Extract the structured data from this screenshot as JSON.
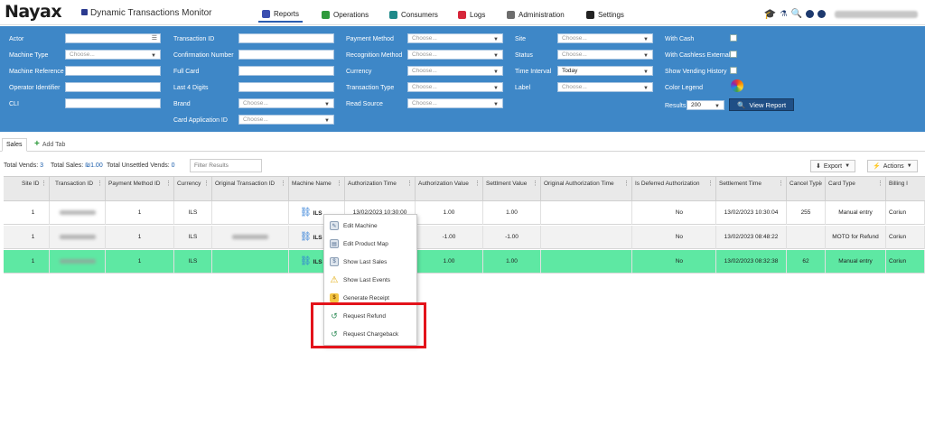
{
  "app": {
    "logo": "Nayax",
    "title": "Dynamic Transactions Monitor"
  },
  "nav": [
    {
      "label": "Reports",
      "color": "#3b4fb0",
      "active": true
    },
    {
      "label": "Operations",
      "color": "#2e9a3c"
    },
    {
      "label": "Consumers",
      "color": "#1f8a8a"
    },
    {
      "label": "Logs",
      "color": "#d6263a"
    },
    {
      "label": "Administration",
      "color": "#6d6d6d"
    },
    {
      "label": "Settings",
      "color": "#222222"
    }
  ],
  "filters": {
    "actor": "Actor",
    "machine_type": "Machine Type",
    "machine_type_value": "Choose...",
    "machine_reference": "Machine Reference",
    "operator_identifier": "Operator Identifier",
    "cli": "CLI",
    "transaction_id": "Transaction ID",
    "confirmation_number": "Confirmation Number",
    "full_card": "Full Card",
    "last4": "Last 4 Digits",
    "brand": "Brand",
    "brand_value": "Choose...",
    "card_application_id": "Card Application ID",
    "card_application_id_value": "Choose...",
    "payment_method": "Payment Method",
    "payment_method_value": "Choose...",
    "recognition_method": "Recognition Method",
    "recognition_method_value": "Choose...",
    "currency": "Currency",
    "currency_value": "Choose...",
    "transaction_type": "Transaction Type",
    "transaction_type_value": "Choose...",
    "read_source": "Read Source",
    "read_source_value": "Choose...",
    "site": "Site",
    "site_value": "Choose...",
    "status": "Status",
    "status_value": "Choose...",
    "time_interval": "Time Interval",
    "time_interval_value": "Today",
    "label": "Label",
    "label_value": "Choose...",
    "with_cash": "With Cash",
    "with_cashless_external": "With Cashless External",
    "show_vending_history": "Show Vending History",
    "color_legend": "Color Legend",
    "results": "Results",
    "results_value": "200",
    "view_report": "View Report"
  },
  "tabs": {
    "sales": "Sales",
    "add_tab": "Add Tab"
  },
  "totals": {
    "vends_label": "Total Vends:",
    "vends_value": "3",
    "sales_label": "Total Sales:",
    "sales_value": "₪1.00",
    "unsettled_label": "Total Unsettled Vends:",
    "unsettled_value": "0",
    "filter_placeholder": "Filter Results"
  },
  "toolbar": {
    "export": "Export",
    "actions": "Actions"
  },
  "grid": {
    "headers": [
      "Site ID",
      "Transaction ID",
      "Payment Method ID",
      "Currency",
      "Original Transaction ID",
      "Machine Name",
      "Authorization Time",
      "Authorization Value",
      "Settlment Value",
      "Original Authorization Time",
      "Is Deferred Authorization",
      "Settlement Time",
      "Cancel Type",
      "Card Type",
      "Billing I"
    ],
    "rows": [
      {
        "site": "1",
        "pm": "1",
        "currency": "ILS",
        "machine": "ILS",
        "auth_time": "13/02/2023 10:30:00",
        "auth_value": "1.00",
        "settl_value": "1.00",
        "deferred": "No",
        "settl_time": "13/02/2023 10:30:04",
        "cancel": "255",
        "card_type": "Manual entry",
        "billing": "Coriun"
      },
      {
        "site": "1",
        "pm": "1",
        "currency": "ILS",
        "machine": "ILS",
        "auth_time": "",
        "auth_value": "-1.00",
        "settl_value": "-1.00",
        "deferred": "No",
        "settl_time": "13/02/2023 08:48:22",
        "cancel": "",
        "card_type": "MOTO for Refund",
        "billing": "Coriun"
      },
      {
        "site": "1",
        "pm": "1",
        "currency": "ILS",
        "machine": "ILS",
        "auth_time": "",
        "auth_value": "1.00",
        "settl_value": "1.00",
        "deferred": "No",
        "settl_time": "13/02/2023 08:32:38",
        "cancel": "62",
        "card_type": "Manual entry",
        "billing": "Coriun"
      }
    ]
  },
  "context_menu": {
    "items": [
      "Edit Machine",
      "Edit Product Map",
      "Show Last Sales",
      "Show Last Events",
      "Generate Receipt",
      "Request Refund",
      "Request Chargeback"
    ]
  },
  "colors": {
    "header_blue": "#3e87c7",
    "selected_row": "#5ee8a3",
    "highlight_red": "#e3131b"
  }
}
